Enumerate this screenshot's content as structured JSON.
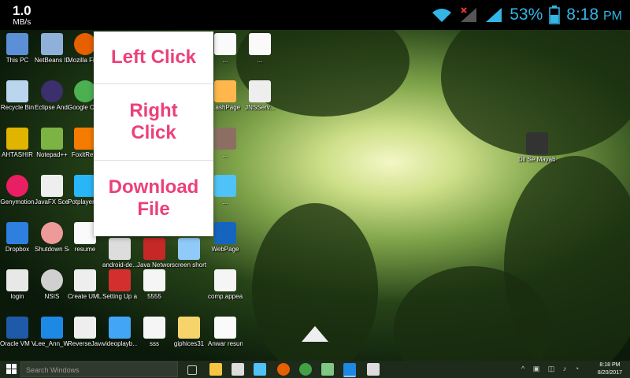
{
  "status_bar": {
    "speed_value": "1.0",
    "speed_unit": "MB/s",
    "battery_percent": "53%",
    "time": "8:18",
    "ampm": "PM",
    "accent_color": "#33b5e5"
  },
  "popup_menu": {
    "items": [
      {
        "label": "Left Click"
      },
      {
        "label": "Right Click"
      },
      {
        "label": "Download File"
      }
    ],
    "text_color": "#ec407a"
  },
  "desktop_icons": [
    {
      "label": "This PC",
      "color": "#5b8fd6"
    },
    {
      "label": "NetBeans IDE 8.1",
      "color": "#8fb0d8"
    },
    {
      "label": "Mozilla Firefox",
      "color": "#e66000"
    },
    {
      "label": "Recycle Bin",
      "color": "#b9d6ee"
    },
    {
      "label": "Eclipse Andro...",
      "color": "#3b2f6e"
    },
    {
      "label": "Google Chrome",
      "color": "#4caf50"
    },
    {
      "label": "AHTASHIR",
      "color": "#e0b400"
    },
    {
      "label": "Notepad++",
      "color": "#7cb342"
    },
    {
      "label": "FoxitRe...",
      "color": "#f57c00"
    },
    {
      "label": "Genymotion",
      "color": "#e91e63"
    },
    {
      "label": "JavaFX Scene Builder 2.0",
      "color": "#eeeeee"
    },
    {
      "label": "Potplayer Bits",
      "color": "#29b6f6"
    },
    {
      "label": "Dropbox",
      "color": "#2d7fe0"
    },
    {
      "label": "Shutdown Schedule",
      "color": "#ef9a9a"
    },
    {
      "label": "resume",
      "color": "#fafafa"
    },
    {
      "label": "android-de...",
      "color": "#dddddd"
    },
    {
      "label": "Java Network Programm...",
      "color": "#c62828"
    },
    {
      "label": "screen short",
      "color": "#90caf9"
    },
    {
      "label": "WebPage",
      "color": "#1565c0"
    },
    {
      "label": "login",
      "color": "#e8e8e8"
    },
    {
      "label": "NSIS",
      "color": "#d0d0d0"
    },
    {
      "label": "Create UML Diagra...",
      "color": "#eeeeee"
    },
    {
      "label": "Setting Up a GitHub Rep...",
      "color": "#d32f2f"
    },
    {
      "label": "5555",
      "color": "#f5f5f5"
    },
    {
      "label": "comp.appea...",
      "color": "#f5f5f5"
    },
    {
      "label": "Oracle VM VirtualBox",
      "color": "#1e5aa8"
    },
    {
      "label": "Lee_Ann_W...",
      "color": "#1e88e5"
    },
    {
      "label": "ReverseJava Classes to...",
      "color": "#eeeeee"
    },
    {
      "label": "videoplayb...",
      "color": "#42a5f5"
    },
    {
      "label": "sss",
      "color": "#f5f5f5"
    },
    {
      "label": "giphices31",
      "color": "#f6d36b"
    },
    {
      "label": "Anwar resume",
      "color": "#fafafa"
    },
    {
      "label": "Dil Se Mayabi Ch...",
      "color": "#333333"
    },
    {
      "label": "...",
      "color": "#fafafa"
    },
    {
      "label": "...",
      "color": "#fafafa"
    },
    {
      "label": "...ashPage",
      "color": "#ffb74d"
    },
    {
      "label": "JNSServ...",
      "color": "#eeeeee"
    },
    {
      "label": "...",
      "color": "#8d6e63"
    },
    {
      "label": "...",
      "color": "#4fc3f7"
    }
  ],
  "taskbar": {
    "search_placeholder": "Search Windows",
    "clock_time": "8:18 PM",
    "clock_date": "8/20/2017"
  }
}
